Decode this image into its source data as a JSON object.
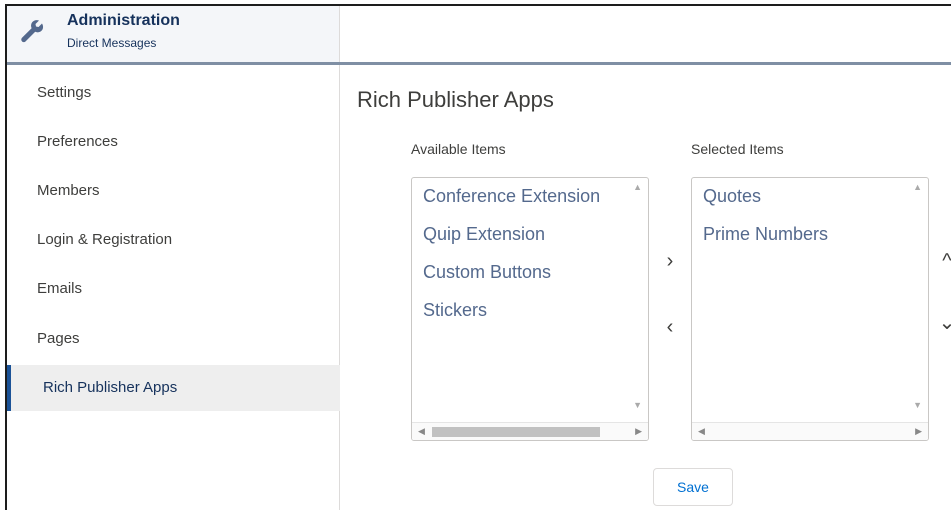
{
  "header": {
    "title": "Administration",
    "subtitle": "Direct Messages",
    "icon": "wrench-icon"
  },
  "sidebar": {
    "items": [
      {
        "label": "Settings"
      },
      {
        "label": "Preferences"
      },
      {
        "label": "Members"
      },
      {
        "label": "Login & Registration"
      },
      {
        "label": "Emails"
      },
      {
        "label": "Pages"
      },
      {
        "label": "Rich Publisher Apps"
      }
    ],
    "active_index": 6
  },
  "main": {
    "title": "Rich Publisher Apps",
    "available_label": "Available Items",
    "selected_label": "Selected Items",
    "available_items": [
      "Conference Extension",
      "Quip Extension",
      "Custom Buttons",
      "Stickers"
    ],
    "selected_items": [
      "Quotes",
      "Prime Numbers"
    ],
    "save_label": "Save"
  },
  "colors": {
    "accent": "#1b5297",
    "link": "#0070d2",
    "item_text": "#54698d"
  }
}
